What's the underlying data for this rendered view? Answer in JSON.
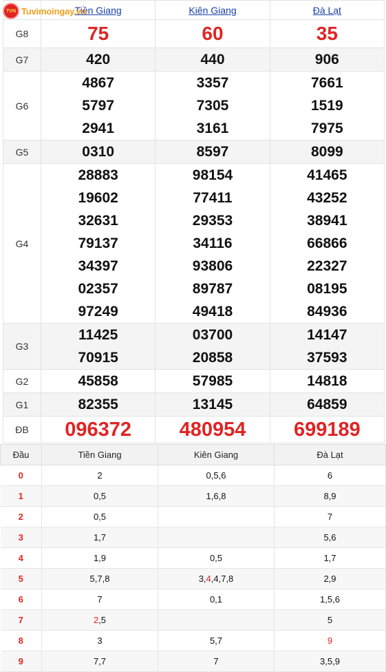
{
  "logo": {
    "badge": "TVN",
    "text": "Tuvimoingay.vn"
  },
  "provinces": [
    "Tiền Giang",
    "Kiên Giang",
    "Đà Lạt"
  ],
  "prizes": [
    {
      "label": "G8",
      "style": "big",
      "values": [
        [
          "75"
        ],
        [
          "60"
        ],
        [
          "35"
        ]
      ]
    },
    {
      "label": "G7",
      "style": "num",
      "values": [
        [
          "420"
        ],
        [
          "440"
        ],
        [
          "906"
        ]
      ]
    },
    {
      "label": "G6",
      "style": "num",
      "values": [
        [
          "4867",
          "5797",
          "2941"
        ],
        [
          "3357",
          "7305",
          "3161"
        ],
        [
          "7661",
          "1519",
          "7975"
        ]
      ]
    },
    {
      "label": "G5",
      "style": "num",
      "values": [
        [
          "0310"
        ],
        [
          "8597"
        ],
        [
          "8099"
        ]
      ]
    },
    {
      "label": "G4",
      "style": "num",
      "values": [
        [
          "28883",
          "19602",
          "32631",
          "79137",
          "34397",
          "02357",
          "97249"
        ],
        [
          "98154",
          "77411",
          "29353",
          "34116",
          "93806",
          "89787",
          "49418"
        ],
        [
          "41465",
          "43252",
          "38941",
          "66866",
          "22327",
          "08195",
          "84936"
        ]
      ]
    },
    {
      "label": "G3",
      "style": "num",
      "values": [
        [
          "11425",
          "70915"
        ],
        [
          "03700",
          "20858"
        ],
        [
          "14147",
          "37593"
        ]
      ]
    },
    {
      "label": "G2",
      "style": "num",
      "values": [
        [
          "45858"
        ],
        [
          "57985"
        ],
        [
          "14818"
        ]
      ]
    },
    {
      "label": "G1",
      "style": "num",
      "values": [
        [
          "82355"
        ],
        [
          "13145"
        ],
        [
          "64859"
        ]
      ]
    },
    {
      "label": "ĐB",
      "style": "db",
      "values": [
        [
          "096372"
        ],
        [
          "480954"
        ],
        [
          "699189"
        ]
      ]
    }
  ],
  "loto": {
    "headers": [
      "Đầu",
      "Tiền Giang",
      "Kiên Giang",
      "Đà Lạt"
    ],
    "rows": [
      {
        "dau": "0",
        "cells": [
          [
            {
              "t": "2"
            }
          ],
          [
            {
              "t": "0,5,6"
            }
          ],
          [
            {
              "t": "6"
            }
          ]
        ]
      },
      {
        "dau": "1",
        "cells": [
          [
            {
              "t": "0,5"
            }
          ],
          [
            {
              "t": "1,6,8"
            }
          ],
          [
            {
              "t": "8,9"
            }
          ]
        ]
      },
      {
        "dau": "2",
        "cells": [
          [
            {
              "t": "0,5"
            }
          ],
          [],
          [
            {
              "t": "7"
            }
          ]
        ]
      },
      {
        "dau": "3",
        "cells": [
          [
            {
              "t": "1,7"
            }
          ],
          [],
          [
            {
              "t": "5,6"
            }
          ]
        ]
      },
      {
        "dau": "4",
        "cells": [
          [
            {
              "t": "1,9"
            }
          ],
          [
            {
              "t": "0,5"
            }
          ],
          [
            {
              "t": "1,7"
            }
          ]
        ]
      },
      {
        "dau": "5",
        "cells": [
          [
            {
              "t": "5,7,8"
            }
          ],
          [
            {
              "t": "3,"
            },
            {
              "t": "4",
              "r": true
            },
            {
              "t": ",4,7,8"
            }
          ],
          [
            {
              "t": "2,9"
            }
          ]
        ]
      },
      {
        "dau": "6",
        "cells": [
          [
            {
              "t": "7"
            }
          ],
          [
            {
              "t": "0,1"
            }
          ],
          [
            {
              "t": "1,5,6"
            }
          ]
        ]
      },
      {
        "dau": "7",
        "cells": [
          [
            {
              "t": "2",
              "r": true
            },
            {
              "t": ",5"
            }
          ],
          [],
          [
            {
              "t": "5"
            }
          ]
        ]
      },
      {
        "dau": "8",
        "cells": [
          [
            {
              "t": "3"
            }
          ],
          [
            {
              "t": "5,7"
            }
          ],
          [
            {
              "t": "9",
              "r": true
            }
          ]
        ]
      },
      {
        "dau": "9",
        "cells": [
          [
            {
              "t": "7,7"
            }
          ],
          [
            {
              "t": "7"
            }
          ],
          [
            {
              "t": "3,5,9"
            }
          ]
        ]
      }
    ]
  }
}
